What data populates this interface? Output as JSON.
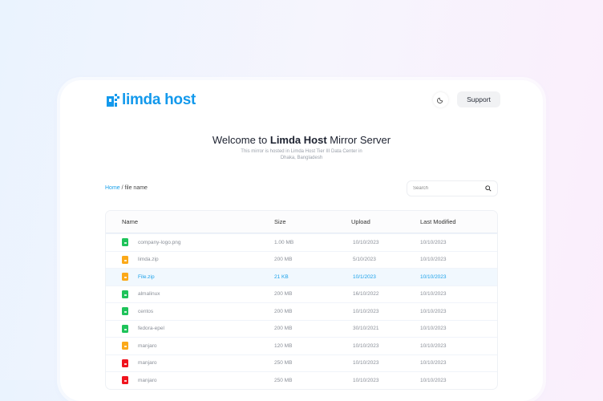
{
  "header": {
    "logo_text": "limda host",
    "support_label": "Support",
    "theme_icon": "moon-icon"
  },
  "hero": {
    "title_pre": "Welcome to ",
    "title_bold": "Limda Host",
    "title_post": " Mirror Server",
    "subtitle": "This mirror is hosted in Limda Host Tier III Data Center in Dhaka, Bangladesh"
  },
  "breadcrumb": {
    "home": "Home",
    "separator": " / ",
    "current": "file name"
  },
  "search": {
    "placeholder": "Search"
  },
  "table": {
    "columns": [
      "Name",
      "Size",
      "Upload",
      "Last Modified"
    ],
    "rows": [
      {
        "name": "company-logo.png",
        "size": "1.00 MB",
        "upload": "10/10/2023",
        "modified": "10/10/2023",
        "color": "#1ec35a"
      },
      {
        "name": "limda.zip",
        "size": "200 MB",
        "upload": "5/10/2023",
        "modified": "10/10/2023",
        "color": "#fba919"
      },
      {
        "name": "File.zip",
        "size": "21 KB",
        "upload": "10/1/2023",
        "modified": "10/10/2023",
        "color": "#fba919",
        "selected": true
      },
      {
        "name": "almalinux",
        "size": "200 MB",
        "upload": "16/10/2022",
        "modified": "10/10/2023",
        "color": "#1ec35a"
      },
      {
        "name": "centos",
        "size": "200 MB",
        "upload": "10/10/2023",
        "modified": "10/10/2023",
        "color": "#1ec35a"
      },
      {
        "name": "fedora-epel",
        "size": "200 MB",
        "upload": "30/10/2021",
        "modified": "10/10/2023",
        "color": "#1ec35a"
      },
      {
        "name": "manjaro",
        "size": "120 MB",
        "upload": "10/10/2023",
        "modified": "10/10/2023",
        "color": "#fba919"
      },
      {
        "name": "manjaro",
        "size": "250 MB",
        "upload": "10/10/2023",
        "modified": "10/10/2023",
        "color": "#f0141e"
      },
      {
        "name": "manjaro",
        "size": "250 MB",
        "upload": "10/10/2023",
        "modified": "10/10/2023",
        "color": "#f0141e"
      }
    ]
  }
}
